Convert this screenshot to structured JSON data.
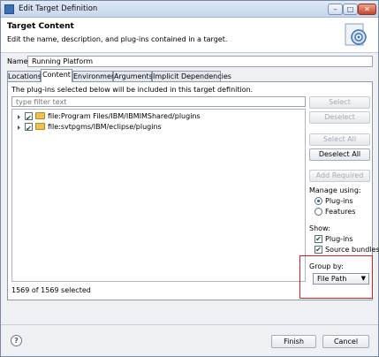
{
  "window": {
    "title": "Edit Target Definition"
  },
  "header": {
    "title": "Target Content",
    "description": "Edit the name, description, and plug-ins contained in a target."
  },
  "name_field": {
    "label": "Name:",
    "value": "Running Platform"
  },
  "tabs": [
    {
      "label": "Locations"
    },
    {
      "label": "Content"
    },
    {
      "label": "Environment"
    },
    {
      "label": "Arguments"
    },
    {
      "label": "Implicit Dependencies"
    }
  ],
  "content": {
    "intro": "The plug-ins selected below will be included in this target definition.",
    "filter_placeholder": "type filter text",
    "tree": [
      {
        "label": "file:Program Files/IBM/IBMIMShared/plugins"
      },
      {
        "label": "file:svtpgms/IBM/eclipse/plugins"
      }
    ],
    "status": "1569 of 1569 selected"
  },
  "buttons": {
    "select": "Select",
    "deselect": "Deselect",
    "select_all": "Select All",
    "deselect_all": "Deselect All",
    "add_required": "Add Required"
  },
  "manage_using": {
    "label": "Manage using:",
    "plugins": "Plug-ins",
    "features": "Features"
  },
  "show": {
    "label": "Show:",
    "plugins": "Plug-ins",
    "source_bundles": "Source bundles"
  },
  "group_by": {
    "label": "Group by:",
    "value": "File Path"
  },
  "footer": {
    "help": "?",
    "finish": "Finish",
    "cancel": "Cancel"
  },
  "window_buttons": {
    "min": "–",
    "max": "□",
    "close": "✕"
  }
}
